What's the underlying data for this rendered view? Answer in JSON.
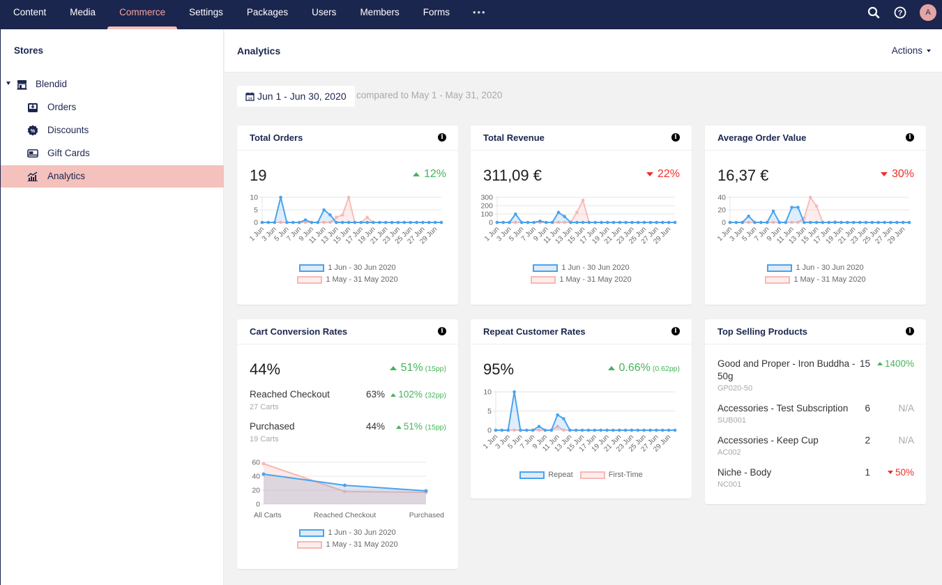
{
  "topnav": {
    "items": [
      {
        "label": "Content",
        "active": false
      },
      {
        "label": "Media",
        "active": false
      },
      {
        "label": "Commerce",
        "active": true
      },
      {
        "label": "Settings",
        "active": false
      },
      {
        "label": "Packages",
        "active": false
      },
      {
        "label": "Users",
        "active": false
      },
      {
        "label": "Members",
        "active": false
      },
      {
        "label": "Forms",
        "active": false
      }
    ],
    "more_label": "•••",
    "search_icon": "search-icon",
    "help_icon": "help-icon",
    "avatar_initial": "A"
  },
  "sidebar": {
    "title": "Stores",
    "store": {
      "label": "Blendid",
      "icon": "store-icon"
    },
    "items": [
      {
        "label": "Orders",
        "icon": "inbox-icon",
        "active": false
      },
      {
        "label": "Discounts",
        "icon": "discount-badge-icon",
        "active": false
      },
      {
        "label": "Gift Cards",
        "icon": "gift-card-icon",
        "active": false
      },
      {
        "label": "Analytics",
        "icon": "analytics-chart-icon",
        "active": true
      }
    ]
  },
  "header": {
    "title": "Analytics",
    "actions_label": "Actions"
  },
  "daterange": {
    "label": "Jun 1 - Jun 30, 2020",
    "compare": "compared to May 1 - May 31, 2020"
  },
  "colors": {
    "current": "#4aa3ec",
    "previous": "#f6b8b4",
    "up": "#45b35a",
    "down": "#f02e28",
    "nav_bg": "#1b264f",
    "accent": "#f5c1bc"
  },
  "legend": {
    "current": "1 Jun - 30 Jun 2020",
    "previous": "1 May - 31 May 2020",
    "repeat": "Repeat",
    "first_time": "First-Time"
  },
  "cards": {
    "total_orders": {
      "title": "Total Orders",
      "value": "19",
      "delta": "12%",
      "direction": "up"
    },
    "total_revenue": {
      "title": "Total Revenue",
      "value": "311,09 €",
      "delta": "22%",
      "direction": "down"
    },
    "aov": {
      "title": "Average Order Value",
      "value": "16,37 €",
      "delta": "30%",
      "direction": "down"
    },
    "cart_conversion": {
      "title": "Cart Conversion Rates",
      "value": "44%",
      "delta": "51%",
      "delta_pp": "(15pp)",
      "direction": "up",
      "rows": [
        {
          "label": "Reached Checkout",
          "sub": "27 Carts",
          "pct": "63%",
          "delta": "102%",
          "delta_pp": "(32pp)",
          "direction": "up"
        },
        {
          "label": "Purchased",
          "sub": "19 Carts",
          "pct": "44%",
          "delta": "51%",
          "delta_pp": "(15pp)",
          "direction": "up"
        }
      ]
    },
    "repeat_customers": {
      "title": "Repeat Customer Rates",
      "value": "95%",
      "delta": "0.66%",
      "delta_pp": "(0.62pp)",
      "direction": "up"
    },
    "top_products": {
      "title": "Top Selling Products",
      "items": [
        {
          "name": "Good and Proper - Iron Buddha - 50g",
          "sku": "GP020-50",
          "qty": "15",
          "delta": "1400%",
          "direction": "up"
        },
        {
          "name": "Accessories - Test Subscription",
          "sku": "SUB001",
          "qty": "6",
          "delta": "N/A",
          "direction": "na"
        },
        {
          "name": "Accessories - Keep Cup",
          "sku": "AC002",
          "qty": "2",
          "delta": "N/A",
          "direction": "na"
        },
        {
          "name": "Niche - Body",
          "sku": "NC001",
          "qty": "1",
          "delta": "50%",
          "direction": "down"
        }
      ]
    }
  },
  "chart_data": [
    {
      "id": "orders",
      "type": "area",
      "title": "Total Orders",
      "x_ticks": [
        "1 Jun",
        "3 Jun",
        "5 Jun",
        "7 Jun",
        "9 Jun",
        "11 Jun",
        "13 Jun",
        "15 Jun",
        "17 Jun",
        "19 Jun",
        "21 Jun",
        "23 Jun",
        "25 Jun",
        "27 Jun",
        "29 Jun"
      ],
      "y_ticks": [
        0,
        5,
        10
      ],
      "ylim": [
        0,
        10
      ],
      "series": [
        {
          "name": "1 Jun - 30 Jun 2020",
          "values": [
            0,
            0,
            0,
            10,
            0,
            0,
            0,
            1,
            0,
            0,
            5,
            3,
            0,
            0,
            0,
            0,
            0,
            0,
            0,
            0,
            0,
            0,
            0,
            0,
            0,
            0,
            0,
            0,
            0,
            0
          ]
        },
        {
          "name": "1 May - 31 May 2020",
          "values": [
            0,
            0,
            0,
            0,
            0,
            0,
            0,
            0,
            0,
            0,
            0,
            0,
            2,
            3,
            10,
            0,
            0,
            2,
            0,
            0,
            0,
            0,
            0,
            0,
            0,
            0,
            0,
            0,
            0,
            0
          ]
        }
      ],
      "legend": "bottom"
    },
    {
      "id": "revenue",
      "type": "area",
      "title": "Total Revenue",
      "x_ticks": [
        "1 Jun",
        "3 Jun",
        "5 Jun",
        "7 Jun",
        "9 Jun",
        "11 Jun",
        "13 Jun",
        "15 Jun",
        "17 Jun",
        "19 Jun",
        "21 Jun",
        "23 Jun",
        "25 Jun",
        "27 Jun",
        "29 Jun"
      ],
      "y_ticks": [
        0,
        100,
        200,
        300
      ],
      "ylim": [
        0,
        300
      ],
      "series": [
        {
          "name": "1 Jun - 30 Jun 2020",
          "values": [
            0,
            0,
            0,
            100,
            0,
            0,
            0,
            15,
            0,
            0,
            120,
            70,
            0,
            0,
            0,
            0,
            0,
            0,
            0,
            0,
            0,
            0,
            0,
            0,
            0,
            0,
            0,
            0,
            0,
            0
          ]
        },
        {
          "name": "1 May - 31 May 2020",
          "values": [
            0,
            0,
            0,
            0,
            0,
            0,
            0,
            0,
            0,
            0,
            0,
            0,
            0,
            120,
            265,
            0,
            0,
            0,
            0,
            0,
            0,
            0,
            0,
            0,
            0,
            0,
            0,
            0,
            0,
            0
          ]
        }
      ],
      "legend": "bottom"
    },
    {
      "id": "aov",
      "type": "area",
      "title": "Average Order Value",
      "x_ticks": [
        "1 Jun",
        "3 Jun",
        "5 Jun",
        "7 Jun",
        "9 Jun",
        "11 Jun",
        "13 Jun",
        "15 Jun",
        "17 Jun",
        "19 Jun",
        "21 Jun",
        "23 Jun",
        "25 Jun",
        "27 Jun",
        "29 Jun"
      ],
      "y_ticks": [
        0,
        20,
        40
      ],
      "ylim": [
        0,
        40
      ],
      "series": [
        {
          "name": "1 Jun - 30 Jun 2020",
          "values": [
            0,
            0,
            0,
            10,
            0,
            0,
            0,
            18,
            0,
            0,
            24,
            24,
            0,
            0,
            0,
            0,
            0,
            0,
            0,
            0,
            0,
            0,
            0,
            0,
            0,
            0,
            0,
            0,
            0,
            0
          ]
        },
        {
          "name": "1 May - 31 May 2020",
          "values": [
            0,
            0,
            0,
            0,
            0,
            0,
            0,
            0,
            0,
            0,
            0,
            0,
            7,
            40,
            26,
            0,
            0,
            1,
            0,
            0,
            0,
            0,
            0,
            0,
            0,
            0,
            0,
            0,
            0,
            0
          ]
        }
      ],
      "legend": "bottom"
    },
    {
      "id": "conversion",
      "type": "area",
      "title": "Cart Conversion Rates",
      "categories": [
        "All Carts",
        "Reached Checkout",
        "Purchased"
      ],
      "y_ticks": [
        0,
        20,
        40,
        60
      ],
      "ylim": [
        0,
        60
      ],
      "series": [
        {
          "name": "1 Jun - 30 Jun 2020",
          "values": [
            43,
            27,
            19
          ]
        },
        {
          "name": "1 May - 31 May 2020",
          "values": [
            58,
            18,
            17
          ]
        }
      ],
      "legend": "bottom"
    },
    {
      "id": "repeat",
      "type": "area",
      "title": "Repeat Customer Rates",
      "x_ticks": [
        "1 Jun",
        "3 Jun",
        "5 Jun",
        "7 Jun",
        "9 Jun",
        "11 Jun",
        "13 Jun",
        "15 Jun",
        "17 Jun",
        "19 Jun",
        "21 Jun",
        "23 Jun",
        "25 Jun",
        "27 Jun",
        "29 Jun"
      ],
      "y_ticks": [
        0,
        5,
        10
      ],
      "ylim": [
        0,
        10
      ],
      "series": [
        {
          "name": "Repeat",
          "values": [
            0,
            0,
            0,
            10,
            0,
            0,
            0,
            1,
            0,
            0,
            4,
            3,
            0,
            0,
            0,
            0,
            0,
            0,
            0,
            0,
            0,
            0,
            0,
            0,
            0,
            0,
            0,
            0,
            0,
            0
          ]
        },
        {
          "name": "First-Time",
          "values": [
            0,
            0,
            0,
            0,
            0,
            0,
            0,
            0,
            0,
            0,
            1,
            0,
            0,
            0,
            0,
            0,
            0,
            0,
            0,
            0,
            0,
            0,
            0,
            0,
            0,
            0,
            0,
            0,
            0,
            0
          ]
        }
      ],
      "legend": "bottom"
    }
  ]
}
